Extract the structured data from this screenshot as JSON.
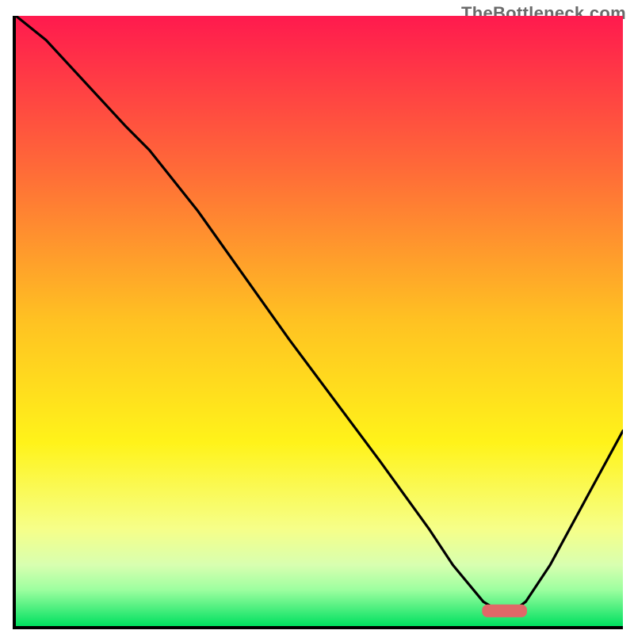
{
  "watermark": "TheBottleneck.com",
  "chart_data": {
    "type": "line",
    "title": "",
    "xlabel": "",
    "ylabel": "",
    "xlim": [
      0,
      100
    ],
    "ylim": [
      0,
      100
    ],
    "grid": false,
    "gradient_stops": [
      {
        "offset": 0,
        "color": "#ff1a4e"
      },
      {
        "offset": 25,
        "color": "#ff6a38"
      },
      {
        "offset": 50,
        "color": "#ffc222"
      },
      {
        "offset": 70,
        "color": "#fff31a"
      },
      {
        "offset": 84,
        "color": "#f6ff88"
      },
      {
        "offset": 90,
        "color": "#d8ffb0"
      },
      {
        "offset": 94,
        "color": "#9effa0"
      },
      {
        "offset": 100,
        "color": "#00e060"
      }
    ],
    "series": [
      {
        "name": "bottleneck-curve",
        "color": "#000000",
        "x": [
          0,
          5,
          18,
          22,
          30,
          45,
          60,
          68,
          72,
          77,
          79.5,
          82,
          84,
          88,
          94,
          100
        ],
        "y": [
          100,
          96,
          82,
          78,
          68,
          47,
          27,
          16,
          10,
          4,
          2.5,
          2.5,
          4,
          10,
          21,
          32
        ]
      }
    ],
    "marker": {
      "name": "target-range",
      "shape": "rounded-bar",
      "color": "#e06868",
      "x_start": 76.8,
      "x_end": 84.2,
      "y": 2.5,
      "height": 2.1
    }
  }
}
